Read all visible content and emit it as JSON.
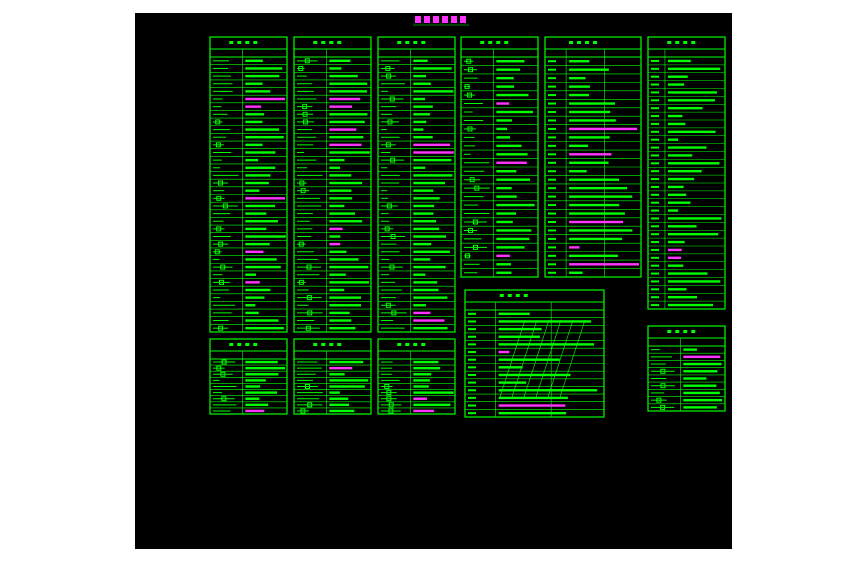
{
  "drawing": {
    "background": "#000000",
    "line_color": "#00ff00",
    "accent_color": "#ff33ff",
    "sheet_title": "",
    "panels": [
      {
        "id": "panel-1",
        "rows": 36,
        "symbol_col": true
      },
      {
        "id": "panel-2",
        "rows": 36,
        "symbol_col": true
      },
      {
        "id": "panel-3",
        "rows": 36,
        "symbol_col": true
      },
      {
        "id": "panel-4",
        "rows": 26,
        "symbol_col": true
      },
      {
        "id": "panel-5",
        "rows": 26,
        "symbol_col": false
      },
      {
        "id": "panel-6",
        "rows": 32,
        "symbol_col": false
      },
      {
        "id": "panel-7",
        "rows": 9,
        "symbol_col": true
      },
      {
        "id": "panel-8",
        "rows": 9,
        "symbol_col": true
      },
      {
        "id": "panel-9",
        "rows": 9,
        "symbol_col": true
      },
      {
        "id": "panel-10",
        "rows": 14,
        "symbol_col": false
      },
      {
        "id": "panel-11",
        "rows": 9,
        "symbol_col": true
      }
    ]
  }
}
